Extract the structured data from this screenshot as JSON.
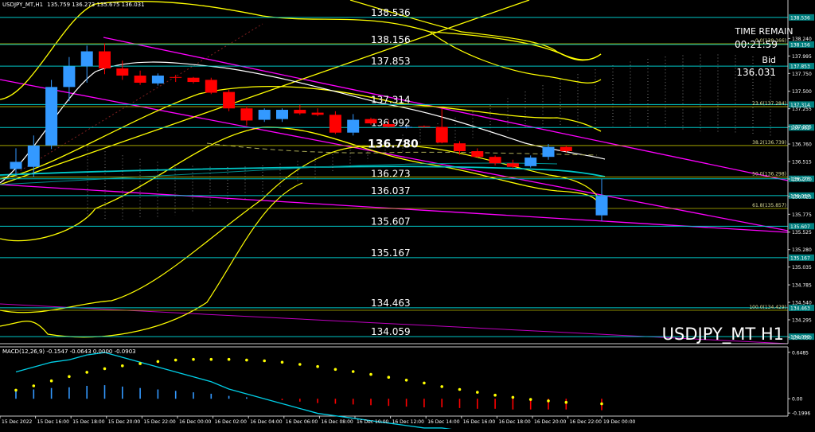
{
  "window": {
    "title": "USDJPY_MT,H1",
    "ohlc": "135.759 136.273 135.675 136.031",
    "watermark": "USDJPY_MT H1"
  },
  "info_panel": {
    "time_remain_label": "TIME REMAIN",
    "time_remain_value": "00:21:59",
    "bid_label": "Bid",
    "bid_value": "136.031"
  },
  "colors": {
    "background": "#000000",
    "bull": "#3399ff",
    "bear": "#ff0000",
    "level_line": "#00c8c8",
    "moving_average": "#ffff00",
    "trend_channel": "#ff00ff",
    "fib_line": "#bbbb00",
    "macd_signal": "#00d0e8",
    "macd_dots": "#ffff00",
    "tag_bg": "#007f7f"
  },
  "chart_data": [
    {
      "type": "candlestick",
      "title": "USDJPY_MT,H1",
      "ylim": [
        133.96,
        138.78
      ],
      "time_axis": [
        "15 Dec 2022",
        "15 Dec 16:00",
        "15 Dec 18:00",
        "15 Dec 20:00",
        "15 Dec 22:00",
        "16 Dec 00:00",
        "16 Dec 02:00",
        "16 Dec 04:00",
        "16 Dec 06:00",
        "16 Dec 08:00",
        "16 Dec 10:00",
        "16 Dec 12:00",
        "16 Dec 14:00",
        "16 Dec 16:00",
        "16 Dec 18:00",
        "16 Dec 20:00",
        "16 Dec 22:00",
        "19 Dec 00:00"
      ],
      "y_ticks": [
        "138.240",
        "137.995",
        "137.750",
        "137.500",
        "137.255",
        "137.005",
        "136.760",
        "136.515",
        "136.270",
        "136.025",
        "135.775",
        "135.525",
        "135.280",
        "135.035",
        "134.785",
        "134.540",
        "134.295",
        "134.050"
      ],
      "candles": [
        {
          "o": 136.41,
          "h": 136.7,
          "l": 136.31,
          "c": 136.51
        },
        {
          "o": 136.44,
          "h": 136.88,
          "l": 136.3,
          "c": 136.74
        },
        {
          "o": 136.74,
          "h": 137.66,
          "l": 136.69,
          "c": 137.56
        },
        {
          "o": 137.56,
          "h": 137.98,
          "l": 137.36,
          "c": 137.85
        },
        {
          "o": 137.85,
          "h": 138.14,
          "l": 137.62,
          "c": 138.06
        },
        {
          "o": 138.06,
          "h": 138.17,
          "l": 137.74,
          "c": 137.82
        },
        {
          "o": 137.82,
          "h": 137.93,
          "l": 137.66,
          "c": 137.72
        },
        {
          "o": 137.72,
          "h": 137.79,
          "l": 137.59,
          "c": 137.62
        },
        {
          "o": 137.61,
          "h": 137.75,
          "l": 137.58,
          "c": 137.72
        },
        {
          "o": 137.7,
          "h": 137.73,
          "l": 137.63,
          "c": 137.69
        },
        {
          "o": 137.69,
          "h": 137.7,
          "l": 137.61,
          "c": 137.63
        },
        {
          "o": 137.66,
          "h": 137.69,
          "l": 137.46,
          "c": 137.48
        },
        {
          "o": 137.49,
          "h": 137.52,
          "l": 137.22,
          "c": 137.26
        },
        {
          "o": 137.26,
          "h": 137.29,
          "l": 137.02,
          "c": 137.09
        },
        {
          "o": 137.1,
          "h": 137.26,
          "l": 137.07,
          "c": 137.24
        },
        {
          "o": 137.11,
          "h": 137.26,
          "l": 137.07,
          "c": 137.24
        },
        {
          "o": 137.24,
          "h": 137.31,
          "l": 137.17,
          "c": 137.19
        },
        {
          "o": 137.2,
          "h": 137.26,
          "l": 137.15,
          "c": 137.17
        },
        {
          "o": 137.17,
          "h": 137.22,
          "l": 136.9,
          "c": 136.92
        },
        {
          "o": 136.92,
          "h": 137.18,
          "l": 136.88,
          "c": 137.1
        },
        {
          "o": 137.11,
          "h": 137.13,
          "l": 137.03,
          "c": 137.05
        },
        {
          "o": 137.04,
          "h": 137.1,
          "l": 136.99,
          "c": 137.0
        },
        {
          "o": 137.0,
          "h": 137.01,
          "l": 136.98,
          "c": 137.0
        },
        {
          "o": 137.01,
          "h": 137.02,
          "l": 136.99,
          "c": 137.0
        },
        {
          "o": 137.0,
          "h": 137.26,
          "l": 136.77,
          "c": 136.78
        },
        {
          "o": 136.77,
          "h": 136.8,
          "l": 136.61,
          "c": 136.66
        },
        {
          "o": 136.66,
          "h": 136.7,
          "l": 136.57,
          "c": 136.58
        },
        {
          "o": 136.58,
          "h": 136.6,
          "l": 136.46,
          "c": 136.49
        },
        {
          "o": 136.49,
          "h": 136.54,
          "l": 136.42,
          "c": 136.44
        },
        {
          "o": 136.45,
          "h": 136.6,
          "l": 136.43,
          "c": 136.57
        },
        {
          "o": 136.58,
          "h": 136.76,
          "l": 136.54,
          "c": 136.72
        },
        {
          "o": 136.72,
          "h": 136.74,
          "l": 136.64,
          "c": 136.66
        },
        {
          "o": 135.76,
          "h": 136.27,
          "l": 135.68,
          "c": 136.03
        }
      ],
      "horizontal_levels": [
        {
          "price": 138.536,
          "label": "138.536",
          "tag": "138.536"
        },
        {
          "price": 138.156,
          "label": "138.156",
          "tag": "138.156"
        },
        {
          "price": 137.853,
          "label": "137.853",
          "tag": "137.853"
        },
        {
          "price": 137.314,
          "label": "137.314",
          "tag": "137.314"
        },
        {
          "price": 136.992,
          "label": "136.992",
          "tag": "136.992"
        },
        {
          "price": 136.273,
          "label": "136.273",
          "tag": "136.273"
        },
        {
          "price": 136.037,
          "label": "136.037",
          "tag": "136.037"
        },
        {
          "price": 135.607,
          "label": "135.607",
          "tag": "135.607"
        },
        {
          "price": 135.167,
          "label": "135.167",
          "tag": "135.167"
        },
        {
          "price": 134.463,
          "label": "134.463",
          "tag": "134.463"
        },
        {
          "price": 134.059,
          "label": "134.059",
          "tag": "134.059"
        }
      ],
      "fib_levels": [
        {
          "price": 138.166,
          "label": "0.0(138.166)"
        },
        {
          "price": 137.284,
          "label": "23.6(137.284)"
        },
        {
          "price": 136.739,
          "label": "38.2(136.739)"
        },
        {
          "price": 136.298,
          "label": "50.0(136.298)"
        },
        {
          "price": 135.857,
          "label": "61.8(135.857)"
        },
        {
          "price": 134.429,
          "label": "100.0(134.429)"
        }
      ],
      "highlight_label": {
        "price": 136.78,
        "text": "136.780"
      }
    },
    {
      "type": "bar",
      "title": "MACD(12,26,9) -0.1547 -0.0643 0.0000 -0.0903",
      "ylim": [
        -0.22,
        0.68
      ],
      "y_ticks": [
        "0.6485",
        "0.00",
        "-0.1996"
      ],
      "histogram": [
        0.11,
        0.13,
        0.15,
        0.16,
        0.18,
        0.19,
        0.17,
        0.15,
        0.13,
        0.11,
        0.09,
        0.07,
        0.04,
        0.02,
        0.0,
        -0.02,
        -0.04,
        -0.06,
        -0.07,
        -0.08,
        -0.09,
        -0.1,
        -0.11,
        -0.12,
        -0.12,
        -0.13,
        -0.14,
        -0.14,
        -0.15,
        -0.15,
        -0.15,
        -0.15,
        -0.16
      ],
      "signal_dots": [
        0.12,
        0.18,
        0.25,
        0.31,
        0.37,
        0.42,
        0.46,
        0.49,
        0.52,
        0.54,
        0.55,
        0.55,
        0.55,
        0.54,
        0.53,
        0.51,
        0.48,
        0.45,
        0.41,
        0.38,
        0.34,
        0.3,
        0.26,
        0.22,
        0.17,
        0.13,
        0.09,
        0.05,
        0.02,
        -0.01,
        -0.03,
        -0.05,
        -0.07
      ]
    }
  ]
}
